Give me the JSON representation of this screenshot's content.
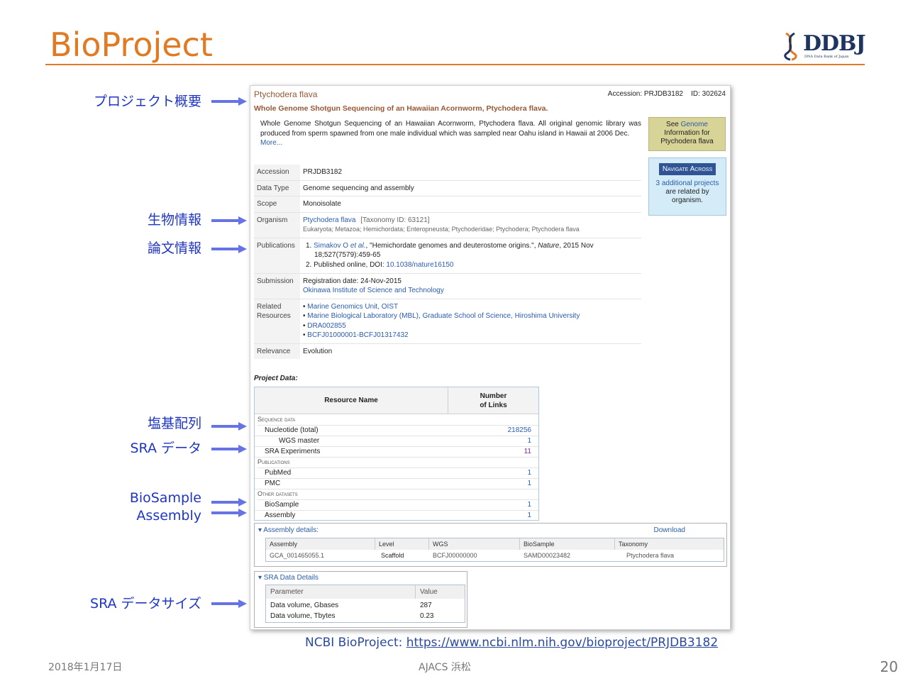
{
  "slide": {
    "title": "BioProject",
    "logo_text": "DDBJ",
    "logo_sub": "DNA Data Bank of Japan",
    "labels": [
      "プロジェクト概要",
      "生物情報",
      "論文情報",
      "塩基配列",
      "SRA データ",
      "BioSample",
      "Assembly",
      "SRA データサイズ"
    ],
    "ncbi_prefix": "NCBI BioProject: ",
    "ncbi_url": "https://www.ncbi.nlm.nih.gov/bioproject/PRJDB3182",
    "footer_date": "2018年1月17日",
    "footer_center": "AJACS 浜松",
    "page_number": "20",
    "accent_color": "#e07b24",
    "label_color": "#1f35c4"
  },
  "project": {
    "name": "Ptychodera flava",
    "accession_line": "Accession: PRJDB3182    ID: 302624",
    "title": "Whole Genome Shotgun Sequencing of an Hawaiian Acornworm, Ptychodera flava.",
    "description": "Whole Genome Shotgun Sequencing of an Hawaiian Acornworm, Ptychodera flava. All original genomic library was produced from sperm spawned from one male individual which was sampled near Oahu island in Hawaii at 2006 Dec.",
    "more": "More...",
    "see_genome": {
      "pre": "See ",
      "link": "Genome",
      "post": "Information for Ptychodera flava"
    },
    "navigate": {
      "button": "Navigate Across",
      "link": "3 additional projects",
      "post": "are related by organism."
    }
  },
  "info": {
    "accession": {
      "k": "Accession",
      "v": "PRJDB3182"
    },
    "data_type": {
      "k": "Data Type",
      "v": "Genome sequencing and assembly"
    },
    "scope": {
      "k": "Scope",
      "v": "Monoisolate"
    },
    "organism": {
      "k": "Organism",
      "name": "Ptychodera flava",
      "taxid": "[Taxonomy ID: 63121]",
      "lineage": "Eukaryota; Metazoa; Hemichordata; Enteropneusta; Ptychoderidae; Ptychodera; Ptychodera flava"
    },
    "publications": {
      "k": "Publications",
      "p1_num": "1.",
      "p1_author": "Simakov O ",
      "p1_etal": "et al.",
      "p1_rest": ", \"Hemichordate genomes and deuterostome origins.\", ",
      "p1_journal": "Nature",
      "p1_date": ", 2015 Nov 18;527(7579):459-65",
      "p2_num": "2.",
      "p2_text": "Published online, DOI: ",
      "p2_doi": "10.1038/nature16150"
    },
    "submission": {
      "k": "Submission",
      "date": "Registration date: 24-Nov-2015",
      "org": "Okinawa Institute of Science and Technology"
    },
    "related": {
      "k1": "Related",
      "k2": "Resources",
      "items": [
        "Marine Genomics Unit, OIST",
        "Marine Biological Laboratory (MBL), Graduate School of Science, Hiroshima University",
        "DRA002855",
        "BCFJ01000001-BCFJ01317432"
      ]
    },
    "relevance": {
      "k": "Relevance",
      "v": "Evolution"
    }
  },
  "project_data": {
    "title": "Project Data:",
    "head_name": "Resource Name",
    "head_links1": "Number",
    "head_links2": "of Links",
    "sections": {
      "sequence": "Sequence data",
      "publications": "Publications",
      "other": "Other datasets"
    },
    "rows": {
      "nucleotide": {
        "name": "Nucleotide (total)",
        "value": "218256"
      },
      "wgs": {
        "name": "WGS master",
        "value": "1"
      },
      "sra": {
        "name": "SRA Experiments",
        "value": "11"
      },
      "pubmed": {
        "name": "PubMed",
        "value": "1"
      },
      "pmc": {
        "name": "PMC",
        "value": "1"
      },
      "biosample": {
        "name": "BioSample",
        "value": "1"
      },
      "assembly": {
        "name": "Assembly",
        "value": "1"
      }
    }
  },
  "assembly_details": {
    "header": "▾ Assembly details:",
    "download": "Download",
    "columns": [
      "Assembly",
      "Level",
      "WGS",
      "BioSample",
      "Taxonomy"
    ],
    "row": [
      "GCA_001465055.1",
      "Scaffold",
      "BCFJ00000000",
      "SAMD00023482",
      "Ptychodera flava"
    ]
  },
  "sra_details": {
    "header": "▾ SRA Data Details",
    "columns": [
      "Parameter",
      "Value"
    ],
    "rows": [
      [
        "Data volume, Gbases",
        "287"
      ],
      [
        "Data volume, Tbytes",
        "0.23"
      ]
    ]
  }
}
